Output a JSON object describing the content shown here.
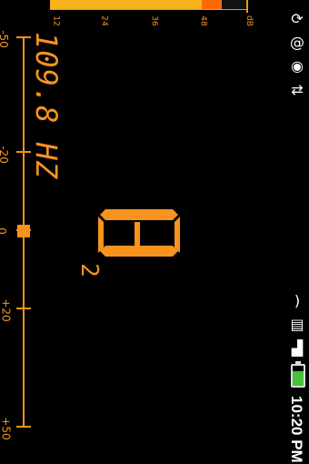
{
  "status": {
    "time": "10:20 PM",
    "battery_level": 0.75,
    "icons": [
      "sync-icon",
      "at-icon",
      "location-icon",
      "usb-icon",
      "wifi-icon",
      "sd-card-icon",
      "signal-icon"
    ]
  },
  "meter": {
    "ticks": [
      "12",
      "24",
      "36",
      "48",
      "dB"
    ],
    "level_db": 46,
    "peak_db": 52,
    "max_db": 60
  },
  "tuner": {
    "frequency": "109.8 HZ",
    "note": "A",
    "octave": "2",
    "cents_offset": 0,
    "scale": [
      "-50",
      "-20",
      "0",
      "+20",
      "+50"
    ]
  },
  "colors": {
    "accent": "#f7931e",
    "background": "#000000",
    "battery": "#47c23a"
  }
}
